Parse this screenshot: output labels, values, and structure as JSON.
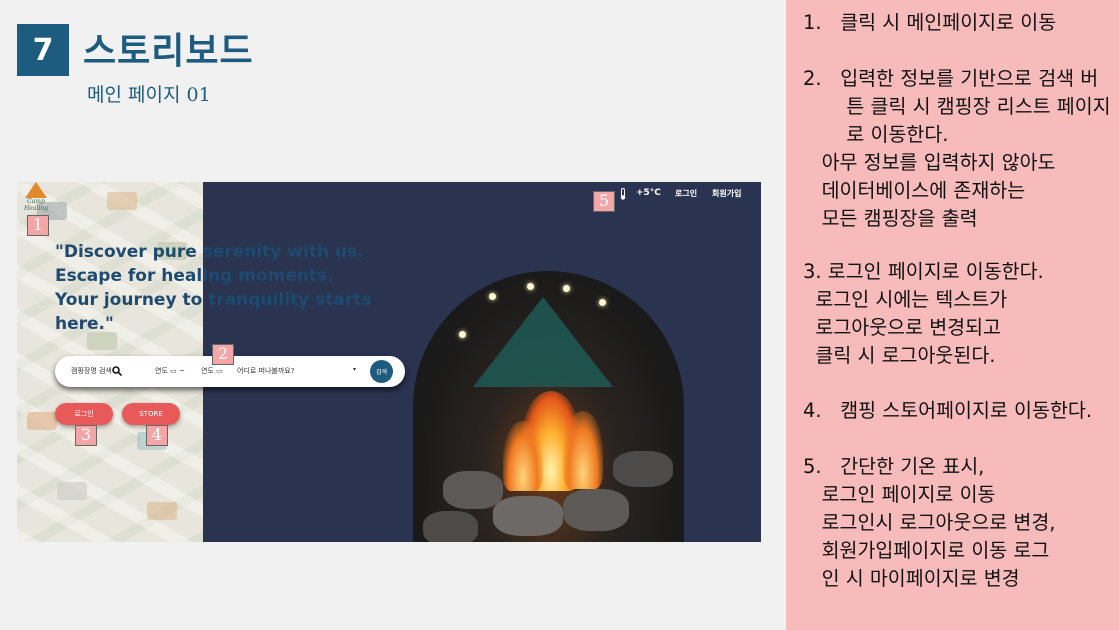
{
  "slide": {
    "number": "7",
    "title": "스토리보드",
    "subtitle": "메인 페이지 01"
  },
  "mock": {
    "logo_text": "Camp Healing",
    "quote": "\"Discover pure serenity with us. Escape for healing moments. Your journey to tranquility starts here.\"",
    "search": {
      "campsite_placeholder": "캠핑장명 검색",
      "date_start": "연도",
      "date_sep": "~",
      "date_end": "연도",
      "destination_placeholder": "어디로 떠나볼까요?",
      "submit_label": "검색"
    },
    "login_label": "로그인",
    "store_label": "STORE",
    "nav": {
      "weather": "+5°C",
      "login": "로그인",
      "signup": "회원가입"
    },
    "tags": [
      "1",
      "2",
      "3",
      "4",
      "5"
    ]
  },
  "notes": [
    "1.   클릭 시 메인페이지로 이동",
    "2.   입력한 정보를 기반으로 검색 버\n       튼 클릭 시 캠핑장 리스트 페이지\n       로 이동한다.\n   아무 정보를 입력하지 않아도\n   데이터베이스에 존재하는\n   모든 캠핑장을 출력",
    "3. 로그인 페이지로 이동한다.\n  로그인 시에는 텍스트가\n  로그아웃으로 변경되고\n  클릭 시 로그아웃된다.",
    "4.   캠핑 스토어페이지로 이동한다.",
    "5.   간단한 기온 표시,\n   로그인 페이지로 이동\n   로그인시 로그아웃으로 변경,\n   회원가입페이지로 이동 로그\n   인 시 마이페이지로 변경"
  ],
  "colors": {
    "brand": "#1d5c7e",
    "notes_bg": "#f8bbbb",
    "button": "#e85a5a",
    "hero_bg": "#2a3451"
  }
}
